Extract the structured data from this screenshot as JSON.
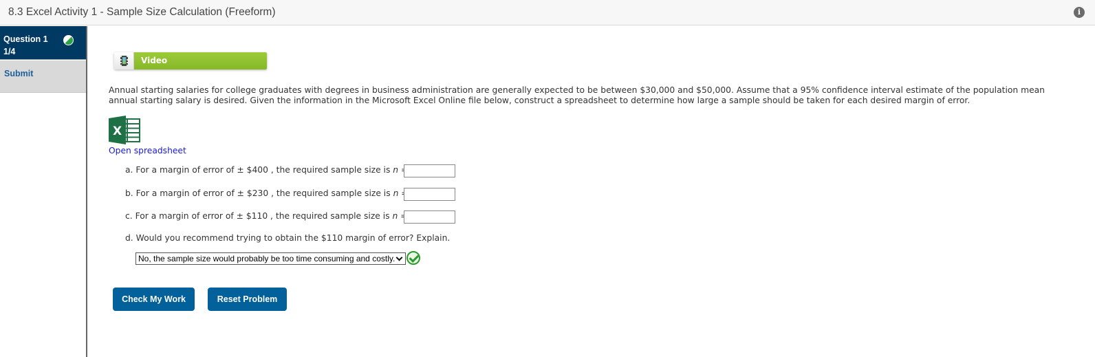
{
  "header": {
    "title": "8.3 Excel Activity 1 - Sample Size Calculation (Freeform)",
    "info_icon": "info-icon"
  },
  "sidebar": {
    "question": {
      "label": "Question 1",
      "progress": "1/4",
      "status_icon": "partial-complete-icon"
    },
    "submit_label": "Submit"
  },
  "video": {
    "icon": "film-icon",
    "label": "Video",
    "color": "#8dbe2d"
  },
  "problem": {
    "intro": "Annual starting salaries for college graduates with degrees in business administration are generally expected to be between $30,000 and $50,000. Assume that a 95% confidence interval estimate of the population mean annual starting salary is desired. Given the information in the Microsoft Excel Online file below, construct a spreadsheet to determine how large a sample should be taken for each desired margin of error.",
    "spreadsheet_icon": "excel-icon",
    "spreadsheet_link": "Open spreadsheet",
    "questions": [
      {
        "letter": "a.",
        "prefix": "For a margin of error of ± $400 , the required sample size is",
        "var": "n",
        "eq": "=",
        "value": ""
      },
      {
        "letter": "b.",
        "prefix": "For a margin of error of ± $230 , the required sample size is",
        "var": "n",
        "eq": "=",
        "value": ""
      },
      {
        "letter": "c.",
        "prefix": "For a margin of error of ± $110 , the required sample size is",
        "var": "n",
        "eq": "=",
        "value": ""
      }
    ],
    "question_d": {
      "letter": "d.",
      "text": "Would you recommend trying to obtain the $110 margin of error? Explain.",
      "selected": "No, the sample size would probably be too time consuming and costly.",
      "result_icon": "correct-check-icon"
    }
  },
  "buttons": {
    "check": "Check My Work",
    "reset": "Reset Problem",
    "color": "#02609a"
  }
}
